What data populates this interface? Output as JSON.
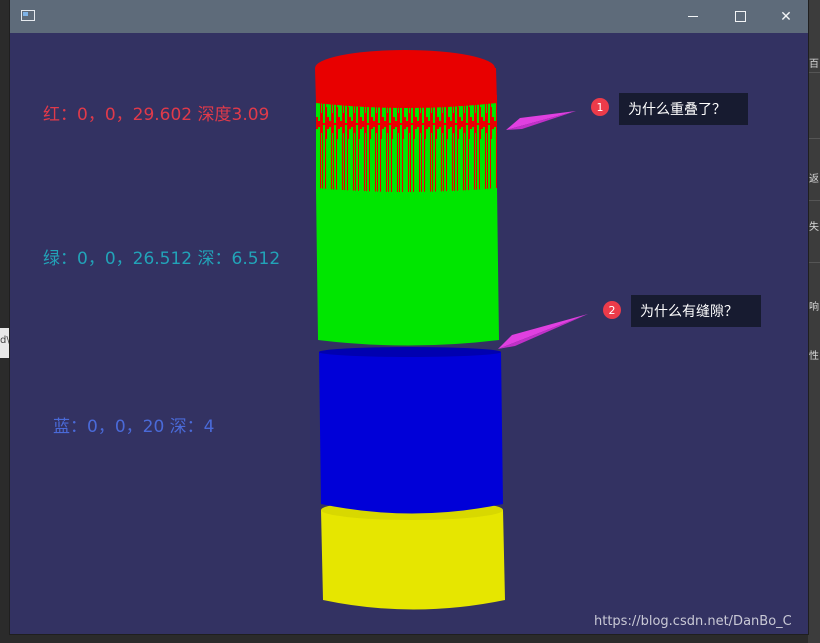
{
  "window": {
    "controls": {
      "minimize_label": "minimize",
      "maximize_label": "maximize",
      "close_label": "✕"
    }
  },
  "labels": {
    "red": "红：0，0，29.602  深度3.09",
    "green": "绿：0，0，26.512 深：6.512",
    "blue": "蓝：0，0，20  深：4"
  },
  "callouts": [
    {
      "number": "1",
      "text": "为什么重叠了？"
    },
    {
      "number": "2",
      "text": "为什么有缝隙？"
    }
  ],
  "watermark": "https://blog.csdn.net/DanBo_C",
  "background_fragments": [
    "百",
    "返",
    "失",
    "响",
    "性"
  ],
  "left_fragment": "d\\",
  "colors": {
    "scene_bg": "#333262",
    "titlebar": "#5e6b7a",
    "cyl_red": "#e80000",
    "cyl_green": "#00e600",
    "cyl_blue": "#0000d8",
    "cyl_yellow": "#e6e600",
    "arrow": "#e040e0"
  }
}
